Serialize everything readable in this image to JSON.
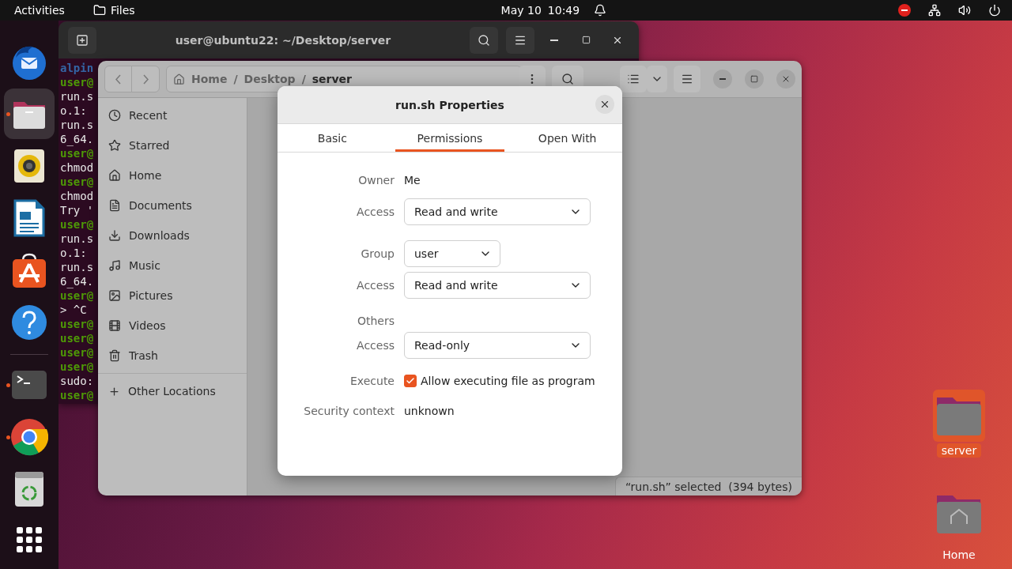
{
  "top_bar": {
    "activities": "Activities",
    "app_menu": "Files",
    "date": "May 10",
    "time": "10:49"
  },
  "dock": [
    {
      "kind": "mail",
      "running": false,
      "selected": false
    },
    {
      "kind": "files",
      "running": true,
      "selected": true
    },
    {
      "kind": "music",
      "running": false,
      "selected": false
    },
    {
      "kind": "writer",
      "running": false,
      "selected": false
    },
    {
      "kind": "store",
      "running": false,
      "selected": false
    },
    {
      "kind": "help",
      "running": false,
      "selected": false
    },
    {
      "kind": "terminal",
      "running": true,
      "selected": false
    },
    {
      "kind": "browser",
      "running": true,
      "selected": false
    },
    {
      "kind": "trash",
      "running": false,
      "selected": false
    },
    {
      "kind": "apps",
      "running": false,
      "selected": false
    }
  ],
  "terminal": {
    "title": "user@ubuntu22: ~/Desktop/server",
    "lines": [
      {
        "kind": "path",
        "text": "alpin"
      },
      {
        "kind": "prompt",
        "text": "user@"
      },
      {
        "kind": "output",
        "text": "run.s"
      },
      {
        "kind": "output",
        "text": "o.1:"
      },
      {
        "kind": "output",
        "text": "run.s"
      },
      {
        "kind": "output",
        "text": "6_64."
      },
      {
        "kind": "prompt",
        "text": "user@"
      },
      {
        "kind": "output",
        "text": "chmod"
      },
      {
        "kind": "prompt",
        "text": "user@"
      },
      {
        "kind": "output",
        "text": "chmod"
      },
      {
        "kind": "output",
        "text": "Try '"
      },
      {
        "kind": "prompt",
        "text": "user@"
      },
      {
        "kind": "output",
        "text": "run.s"
      },
      {
        "kind": "output",
        "text": "o.1:"
      },
      {
        "kind": "output",
        "text": "run.s"
      },
      {
        "kind": "output",
        "text": "6_64."
      },
      {
        "kind": "prompt",
        "text": "user@"
      },
      {
        "kind": "output",
        "text": "> ^C"
      },
      {
        "kind": "prompt",
        "text": "user@"
      },
      {
        "kind": "prompt",
        "text": "user@"
      },
      {
        "kind": "prompt",
        "text": "user@"
      },
      {
        "kind": "prompt",
        "text": "user@"
      },
      {
        "kind": "output",
        "text": "sudo:"
      },
      {
        "kind": "prompt",
        "text": "user@"
      }
    ]
  },
  "files": {
    "path": [
      "Home",
      "Desktop",
      "server"
    ],
    "path_separator": "/",
    "sidebar": [
      {
        "kind": "recent",
        "label": "Recent"
      },
      {
        "kind": "starred",
        "label": "Starred"
      },
      {
        "kind": "home",
        "label": "Home"
      },
      {
        "kind": "documents",
        "label": "Documents"
      },
      {
        "kind": "downloads",
        "label": "Downloads"
      },
      {
        "kind": "music",
        "label": "Music"
      },
      {
        "kind": "pictures",
        "label": "Pictures"
      },
      {
        "kind": "videos",
        "label": "Videos"
      },
      {
        "kind": "trash",
        "label": "Trash"
      }
    ],
    "other_locations": "Other Locations",
    "status": "“run.sh” selected  (394 bytes)"
  },
  "dialog": {
    "title": "run.sh Properties",
    "tabs": [
      {
        "label": "Basic",
        "selected": false
      },
      {
        "label": "Permissions",
        "selected": true
      },
      {
        "label": "Open With",
        "selected": false
      }
    ],
    "owner": {
      "label": "Owner",
      "value": "Me"
    },
    "owner_access": {
      "label": "Access",
      "value": "Read and write"
    },
    "group": {
      "label": "Group",
      "value": "user"
    },
    "group_access": {
      "label": "Access",
      "value": "Read and write"
    },
    "others": {
      "label": "Others"
    },
    "others_access": {
      "label": "Access",
      "value": "Read-only"
    },
    "execute": {
      "label": "Execute",
      "text": "Allow executing file as program",
      "checked": true
    },
    "security": {
      "label": "Security context",
      "value": "unknown"
    }
  },
  "desktop_icons": [
    {
      "kind": "folder",
      "label": "server",
      "selected": true
    },
    {
      "kind": "home",
      "label": "Home",
      "selected": false
    }
  ]
}
